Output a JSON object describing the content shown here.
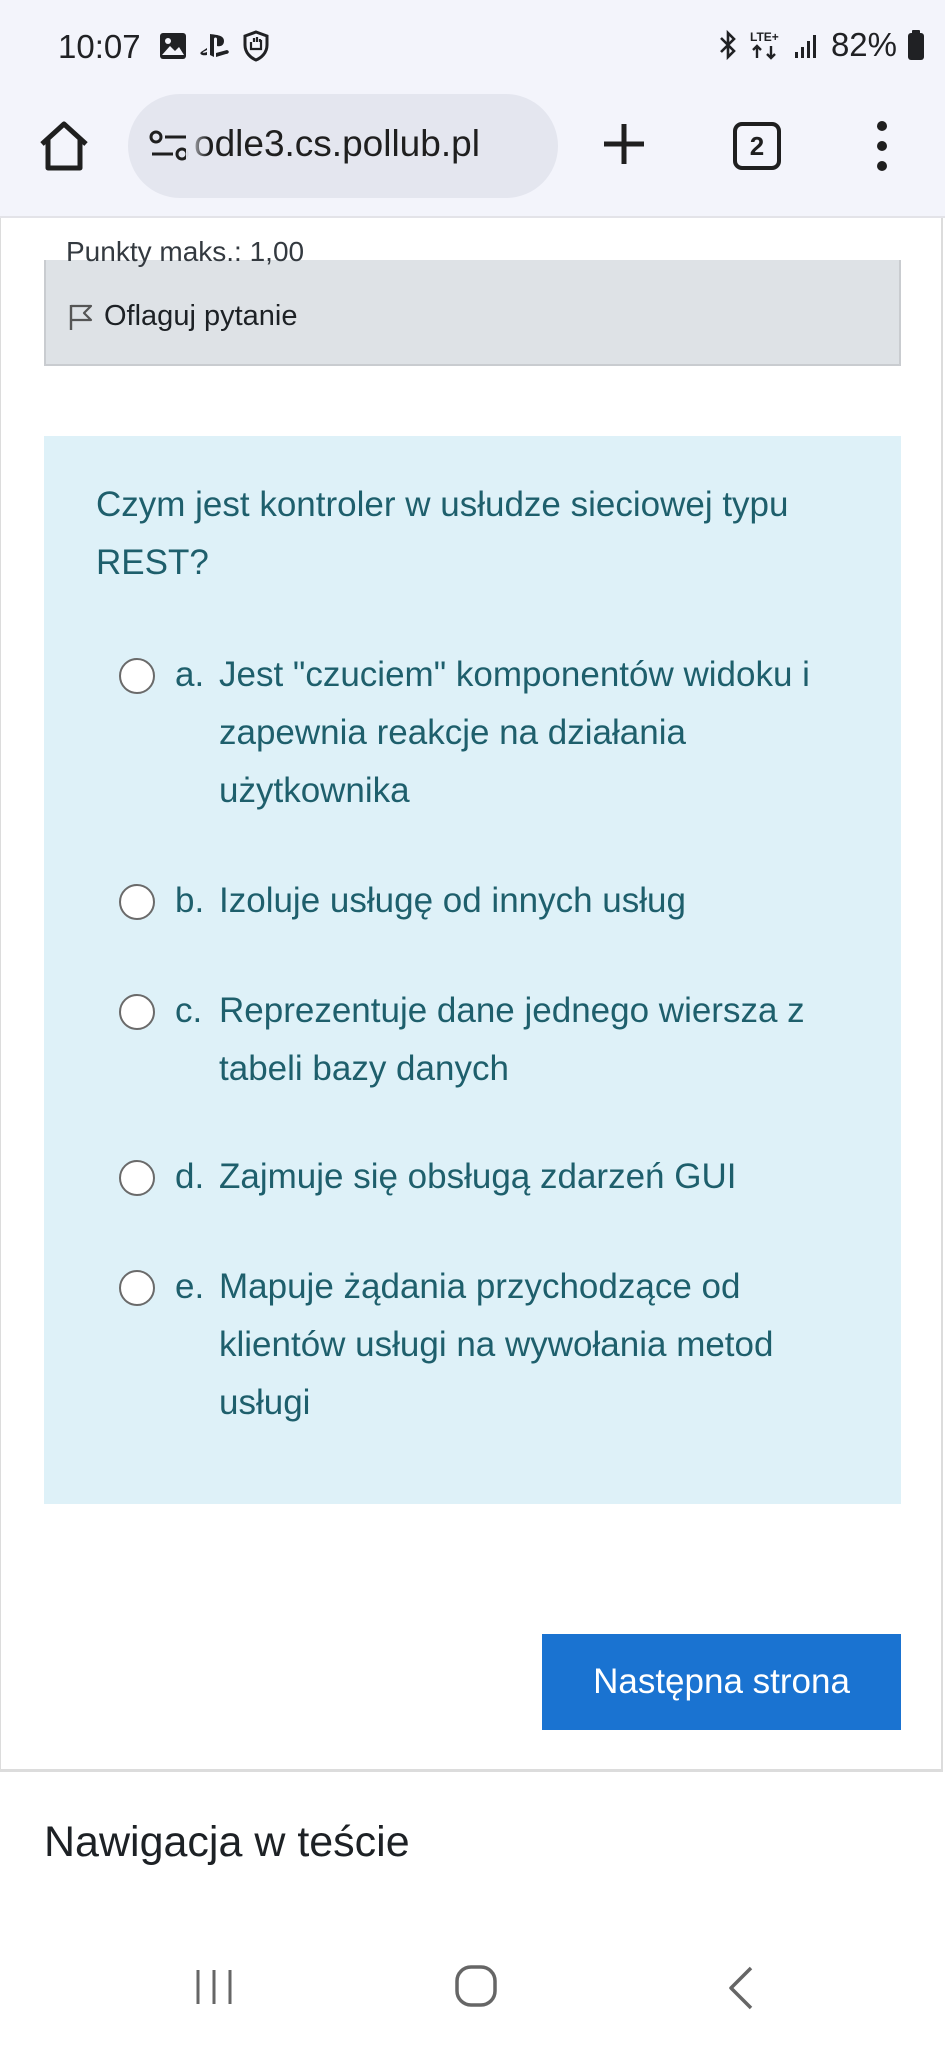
{
  "status_bar": {
    "time": "10:07",
    "network": "LTE+",
    "battery": "82%",
    "icons_left": [
      "gallery-icon",
      "playstation-icon",
      "shield-icon"
    ],
    "icons_right": [
      "bluetooth-icon",
      "lte-icon",
      "signal-icon",
      "battery-icon"
    ]
  },
  "browser": {
    "url": "odle3.cs.pollub.pl",
    "tab_count": "2",
    "icons": [
      "home-icon",
      "site-settings-icon",
      "new-tab-icon",
      "tabs-icon",
      "menu-icon"
    ]
  },
  "info_box": {
    "cut_text": "Punkty maks.: 1,00",
    "flag_label": "Oflaguj pytanie"
  },
  "question": {
    "text": "Czym jest kontroler w usłudze sieciowej typu REST?",
    "answers": [
      {
        "letter": "a.",
        "text": "Jest \"czuciem\" komponentów widoku i zapewnia reakcje na działania użytkownika",
        "selected": false
      },
      {
        "letter": "b.",
        "text": "Izoluje usługę od innych usług",
        "selected": false
      },
      {
        "letter": "c.",
        "text": "Reprezentuje dane jednego wiersza z tabeli bazy danych",
        "selected": false
      },
      {
        "letter": "d.",
        "text": "Zajmuje się obsługą zdarzeń GUI",
        "selected": false
      },
      {
        "letter": "e.",
        "text": "Mapuje żądania przychodzące od klientów usługi na wywołania metod usługi",
        "selected": false
      }
    ]
  },
  "next_button_label": "Następna strona",
  "navigation_heading": "Nawigacja w teście",
  "colors": {
    "accent_button": "#1a73d1",
    "question_bg": "#def1f8",
    "question_text": "#1e5f6c",
    "info_bg": "#dee2e6"
  }
}
